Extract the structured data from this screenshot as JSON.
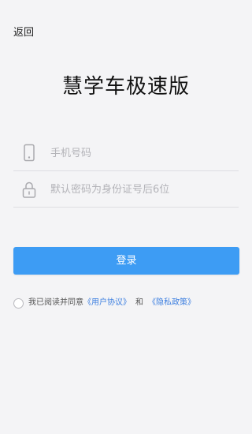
{
  "header": {
    "back_label": "返回"
  },
  "app_title": "慧学车极速版",
  "form": {
    "phone": {
      "icon": "phone-icon",
      "placeholder": "手机号码",
      "value": ""
    },
    "password": {
      "icon": "lock-icon",
      "placeholder": "默认密码为身份证号后6位",
      "value": ""
    },
    "login_label": "登录"
  },
  "agreement": {
    "checked": false,
    "prefix": "我已阅读并同意",
    "user_agreement": "《用户协议》",
    "conjunction": "和",
    "privacy_policy": "《隐私政策》"
  },
  "colors": {
    "background": "#f4f4f6",
    "primary": "#3d9cf4",
    "link": "#3d7fe0"
  }
}
